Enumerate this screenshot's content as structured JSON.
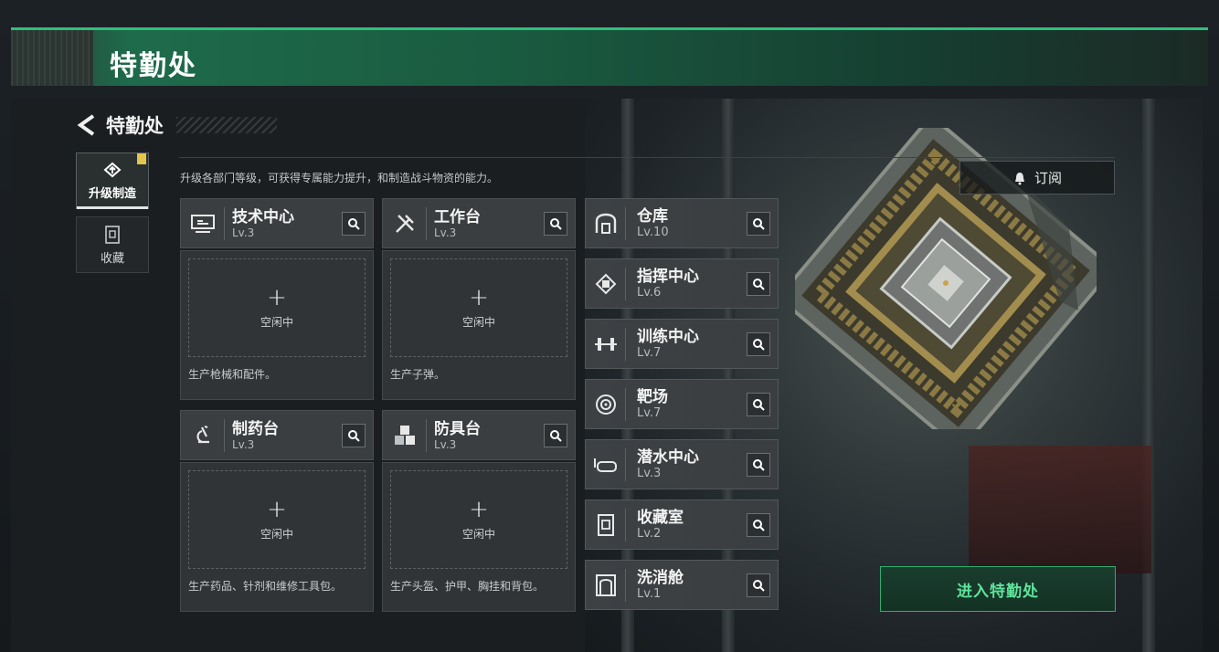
{
  "header": {
    "title": "特勤处"
  },
  "back": {
    "label": "特勤处"
  },
  "nav": [
    {
      "label": "升级制造",
      "icon": "upgrade-icon",
      "active": true
    },
    {
      "label": "收藏",
      "icon": "collection-icon",
      "active": false
    }
  ],
  "intro": "升级各部门等级，可获得专属能力提升，和制造战斗物资的能力。",
  "subscribe_label": "订阅",
  "production": [
    {
      "name": "技术中心",
      "level": "Lv.3",
      "icon": "computer-icon",
      "slot_plus": "+",
      "slot_label": "空闲中",
      "desc": "生产枪械和配件。"
    },
    {
      "name": "工作台",
      "level": "Lv.3",
      "icon": "tools-icon",
      "slot_plus": "+",
      "slot_label": "空闲中",
      "desc": "生产子弹。"
    },
    {
      "name": "制药台",
      "level": "Lv.3",
      "icon": "microscope-icon",
      "slot_plus": "+",
      "slot_label": "空闲中",
      "desc": "生产药品、针剂和维修工具包。"
    },
    {
      "name": "防具台",
      "level": "Lv.3",
      "icon": "armor-blocks-icon",
      "slot_plus": "+",
      "slot_label": "空闲中",
      "desc": "生产头盔、护甲、胸挂和背包。"
    }
  ],
  "facilities": [
    {
      "name": "仓库",
      "level": "Lv.10",
      "icon": "warehouse-icon"
    },
    {
      "name": "指挥中心",
      "level": "Lv.6",
      "icon": "chip-icon"
    },
    {
      "name": "训练中心",
      "level": "Lv.7",
      "icon": "dumbbell-icon"
    },
    {
      "name": "靶场",
      "level": "Lv.7",
      "icon": "target-icon"
    },
    {
      "name": "潜水中心",
      "level": "Lv.3",
      "icon": "diving-mask-icon"
    },
    {
      "name": "收藏室",
      "level": "Lv.2",
      "icon": "display-case-icon"
    },
    {
      "name": "洗消舱",
      "level": "Lv.1",
      "icon": "decon-chamber-icon"
    }
  ],
  "enter_button": "进入特勤处",
  "colors": {
    "accent_green": "#2fbf7c",
    "badge_yellow": "#e2c54c"
  }
}
